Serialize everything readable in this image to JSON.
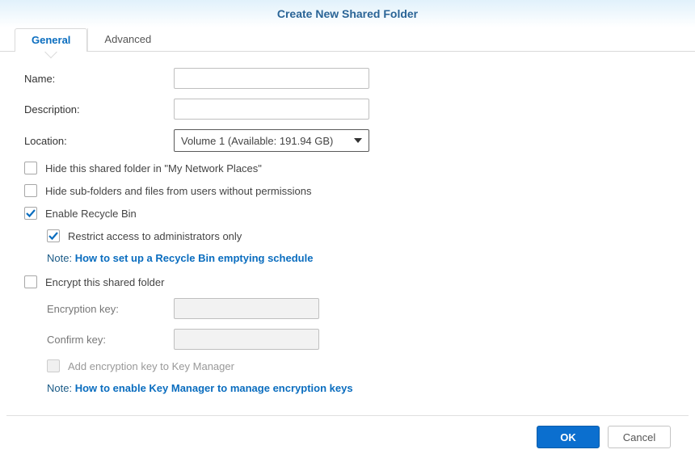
{
  "title": "Create New Shared Folder",
  "tabs": {
    "general": "General",
    "advanced": "Advanced"
  },
  "labels": {
    "name": "Name:",
    "description": "Description:",
    "location": "Location:",
    "encryption_key": "Encryption key:",
    "confirm_key": "Confirm key:"
  },
  "location_value": "Volume 1 (Available: 191.94 GB)",
  "checks": {
    "hide_network": "Hide this shared folder in \"My Network Places\"",
    "hide_subfolders": "Hide sub-folders and files from users without permissions",
    "enable_recycle": "Enable Recycle Bin",
    "restrict_admin": "Restrict access to administrators only",
    "encrypt": "Encrypt this shared folder",
    "add_keymgr": "Add encryption key to Key Manager"
  },
  "notes": {
    "prefix": "Note: ",
    "recycle_link": "How to set up a Recycle Bin emptying schedule",
    "keymgr_link": "How to enable Key Manager to manage encryption keys"
  },
  "buttons": {
    "ok": "OK",
    "cancel": "Cancel"
  }
}
